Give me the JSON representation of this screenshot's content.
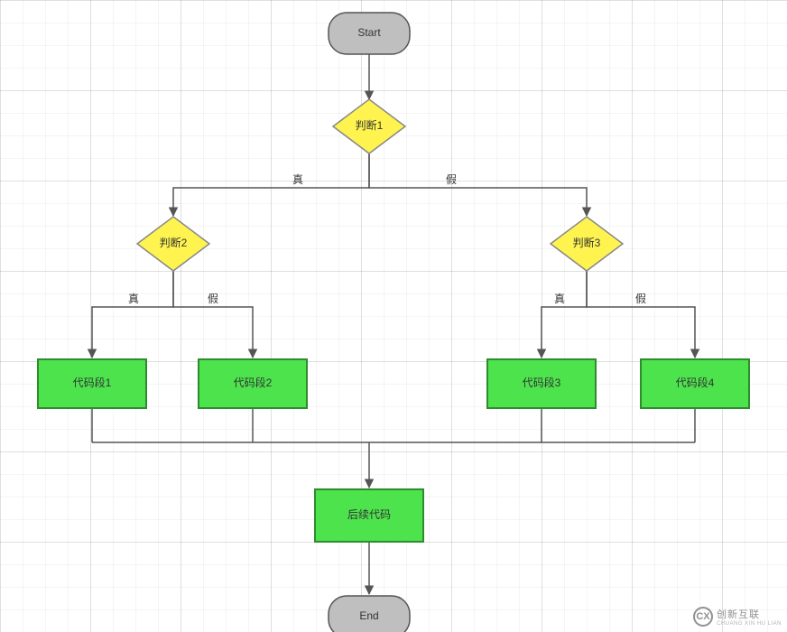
{
  "nodes": {
    "start": "Start",
    "decision1": "判断1",
    "decision2": "判断2",
    "decision3": "判断3",
    "code1": "代码段1",
    "code2": "代码段2",
    "code3": "代码段3",
    "code4": "代码段4",
    "followup": "后续代码",
    "end": "End"
  },
  "edges": {
    "d1_true": "真",
    "d1_false": "假",
    "d2_true": "真",
    "d2_false": "假",
    "d3_true": "真",
    "d3_false": "假"
  },
  "watermark": {
    "logo": "CX",
    "main": "创新互联",
    "sub": "CHUANG XIN HU LIAN"
  },
  "chart_data": {
    "type": "flowchart",
    "nodes": [
      {
        "id": "start",
        "type": "terminator",
        "label": "Start"
      },
      {
        "id": "d1",
        "type": "decision",
        "label": "判断1"
      },
      {
        "id": "d2",
        "type": "decision",
        "label": "判断2"
      },
      {
        "id": "d3",
        "type": "decision",
        "label": "判断3"
      },
      {
        "id": "c1",
        "type": "process",
        "label": "代码段1"
      },
      {
        "id": "c2",
        "type": "process",
        "label": "代码段2"
      },
      {
        "id": "c3",
        "type": "process",
        "label": "代码段3"
      },
      {
        "id": "c4",
        "type": "process",
        "label": "代码段4"
      },
      {
        "id": "fu",
        "type": "process",
        "label": "后续代码"
      },
      {
        "id": "end",
        "type": "terminator",
        "label": "End"
      }
    ],
    "edges": [
      {
        "from": "start",
        "to": "d1"
      },
      {
        "from": "d1",
        "to": "d2",
        "label": "真"
      },
      {
        "from": "d1",
        "to": "d3",
        "label": "假"
      },
      {
        "from": "d2",
        "to": "c1",
        "label": "真"
      },
      {
        "from": "d2",
        "to": "c2",
        "label": "假"
      },
      {
        "from": "d3",
        "to": "c3",
        "label": "真"
      },
      {
        "from": "d3",
        "to": "c4",
        "label": "假"
      },
      {
        "from": "c1",
        "to": "fu"
      },
      {
        "from": "c2",
        "to": "fu"
      },
      {
        "from": "c3",
        "to": "fu"
      },
      {
        "from": "c4",
        "to": "fu"
      },
      {
        "from": "fu",
        "to": "end"
      }
    ]
  }
}
